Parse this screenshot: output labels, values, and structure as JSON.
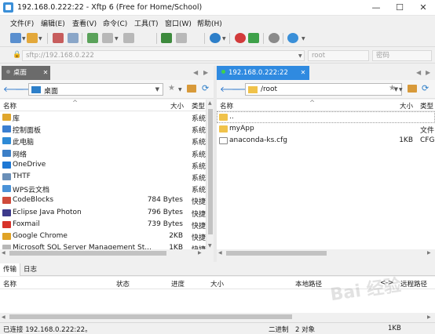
{
  "window": {
    "title": "192.168.0.222:22    - Xftp 6 (Free for Home/School)",
    "controls": {
      "minimize": "—",
      "maximize": "☐",
      "close": "✕"
    }
  },
  "menu": [
    "文件(F)",
    "编辑(E)",
    "查看(V)",
    "命令(C)",
    "工具(T)",
    "窗口(W)",
    "帮助(H)"
  ],
  "address": {
    "host_placeholder": "sftp://192.168.0.222",
    "user_placeholder": "root",
    "password_placeholder": "密码"
  },
  "left": {
    "tab": "桌面",
    "path": "桌面",
    "columns": {
      "name": "名称",
      "size": "大小",
      "type": "类型"
    },
    "files": [
      {
        "name": "库",
        "size": "",
        "type": "系统",
        "icon": "library-icon",
        "color": "#e0a62b"
      },
      {
        "name": "控制面板",
        "size": "",
        "type": "系统",
        "icon": "control-panel-icon",
        "color": "#3b7fd1"
      },
      {
        "name": "此电脑",
        "size": "",
        "type": "系统",
        "icon": "computer-icon",
        "color": "#2d8ad6"
      },
      {
        "name": "网络",
        "size": "",
        "type": "系统",
        "icon": "network-icon",
        "color": "#3c7fc7"
      },
      {
        "name": "OneDrive",
        "size": "",
        "type": "系统",
        "icon": "onedrive-icon",
        "color": "#1e78d4"
      },
      {
        "name": "THTF",
        "size": "",
        "type": "系统",
        "icon": "user-icon",
        "color": "#6a8fb8"
      },
      {
        "name": "WPS云文档",
        "size": "",
        "type": "系统",
        "icon": "wps-cloud-icon",
        "color": "#4a92d8"
      },
      {
        "name": "CodeBlocks",
        "size": "784 Bytes",
        "type": "快捷",
        "icon": "codeblocks-icon",
        "color": "#cf4b3b"
      },
      {
        "name": "Eclipse Java Photon",
        "size": "796 Bytes",
        "type": "快捷",
        "icon": "eclipse-icon",
        "color": "#3d3a8c"
      },
      {
        "name": "Foxmail",
        "size": "739 Bytes",
        "type": "快捷",
        "icon": "foxmail-icon",
        "color": "#d8332a"
      },
      {
        "name": "Google Chrome",
        "size": "2KB",
        "type": "快捷",
        "icon": "chrome-icon",
        "color": "#e0a326"
      },
      {
        "name": "Microsoft SQL Server Management St...",
        "size": "1KB",
        "type": "快捷",
        "icon": "sql-server-icon",
        "color": "#b8b8b8"
      }
    ]
  },
  "right": {
    "tab": "192.168.0.222:22",
    "path": "/root",
    "columns": {
      "name": "名称",
      "size": "大小",
      "type": "类型"
    },
    "files": [
      {
        "name": "..",
        "size": "",
        "type": "",
        "icon": "parent-folder-icon",
        "color": "#f0c24a"
      },
      {
        "name": "myApp",
        "size": "",
        "type": "文件",
        "icon": "folder-icon",
        "color": "#f0c24a"
      },
      {
        "name": "anaconda-ks.cfg",
        "size": "1KB",
        "type": "CFG",
        "icon": "file-icon",
        "color": "#ffffff"
      }
    ]
  },
  "transfer": {
    "tabs": [
      "传输",
      "日志"
    ],
    "columns": [
      "名称",
      "状态",
      "进度",
      "大小",
      "本地路径",
      "<->",
      "远程路径"
    ]
  },
  "status": {
    "connection": "已连接 192.168.0.222:22。",
    "mode": "二进制",
    "objects": "2 对象",
    "size": "1KB"
  },
  "watermark": "Bai 经验",
  "colors": {
    "accent": "#2f8ae0",
    "inactive_tab": "#6b6b6b",
    "tab_dot_active": "#3fd14a"
  }
}
